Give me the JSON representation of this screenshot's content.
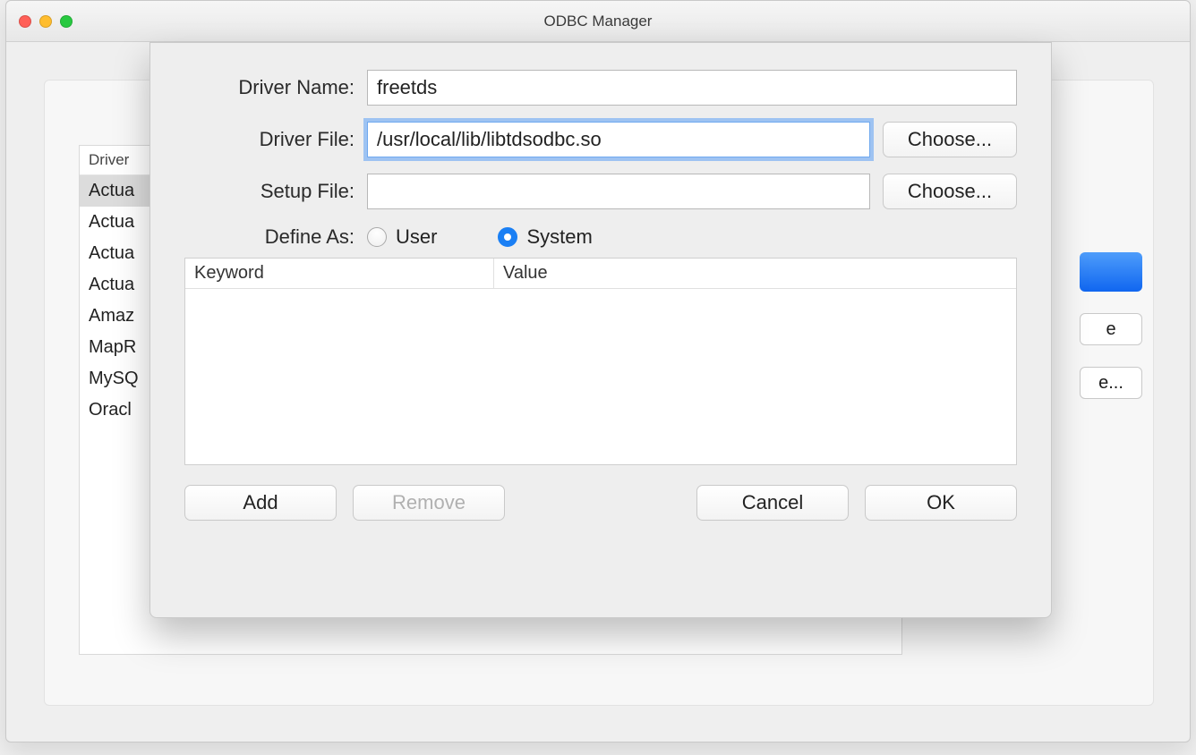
{
  "window": {
    "title": "ODBC Manager"
  },
  "background": {
    "list_header": "Driver",
    "drivers": [
      "Actua",
      "Actua",
      "Actua",
      "Actua",
      "Amaz",
      "MapR",
      "MySQ",
      "Oracl"
    ],
    "side_button2": "e",
    "side_button3": "e..."
  },
  "sheet": {
    "labels": {
      "driver_name": "Driver Name:",
      "driver_file": "Driver File:",
      "setup_file": "Setup File:",
      "define_as": "Define As:"
    },
    "fields": {
      "driver_name": "freetds",
      "driver_file": "/usr/local/lib/libtdsodbc.so",
      "setup_file": ""
    },
    "choose_label": "Choose...",
    "radio": {
      "user": "User",
      "system": "System",
      "selected": "system"
    },
    "kv": {
      "col_keyword": "Keyword",
      "col_value": "Value"
    },
    "buttons": {
      "add": "Add",
      "remove": "Remove",
      "cancel": "Cancel",
      "ok": "OK"
    }
  }
}
